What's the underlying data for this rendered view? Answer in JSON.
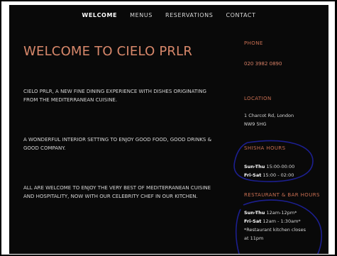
{
  "nav": {
    "items": [
      "WELCOME",
      "MENUS",
      "RESERVATIONS",
      "CONTACT"
    ],
    "active": "WELCOME"
  },
  "main": {
    "title": "WELCOME TO CIELO PRLR",
    "paragraphs": [
      "CIELO PRLR, A NEW FINE DINING EXPERIENCE WITH DISHES ORIGINATING FROM THE MEDITERRANEAN CUISINE.",
      "A WONDERFUL INTERIOR SETTING TO ENJOY GOOD FOOD, GOOD DRINKS & GOOD COMPANY.",
      "ALL ARE WELCOME TO ENJOY THE VERY BEST OF MEDITERRANEAN CUISINE AND HOSPITALITY, NOW WITH OUR CELEBRITY CHEF IN OUR KITCHEN."
    ]
  },
  "sidebar": {
    "phone": {
      "heading": "PHONE",
      "value": "020 3982 0890"
    },
    "location": {
      "heading": "LOCATION",
      "line1": "1 Charcot Rd, London",
      "line2": "NW9 5HG"
    },
    "shisha": {
      "heading": "SHISHA HOURS",
      "rows": [
        {
          "days": "Sun-Thu",
          "hours": "15:00-00:00"
        },
        {
          "days": "Fri-Sat",
          "hours": "15:00 - 02:00"
        }
      ]
    },
    "restaurant": {
      "heading": "RESTAURANT & BAR HOURS",
      "rows": [
        {
          "days": "Sun-Thu",
          "hours": "12am-12pm*"
        },
        {
          "days": "Fri-Sat",
          "hours": "12am - 1:30am*"
        }
      ],
      "note1": "*Restaurant kitchen closes",
      "note2": "at 11pm"
    }
  },
  "colors": {
    "background": "#090909",
    "accent": "#d8886b",
    "annotation": "#1c1f8f"
  }
}
